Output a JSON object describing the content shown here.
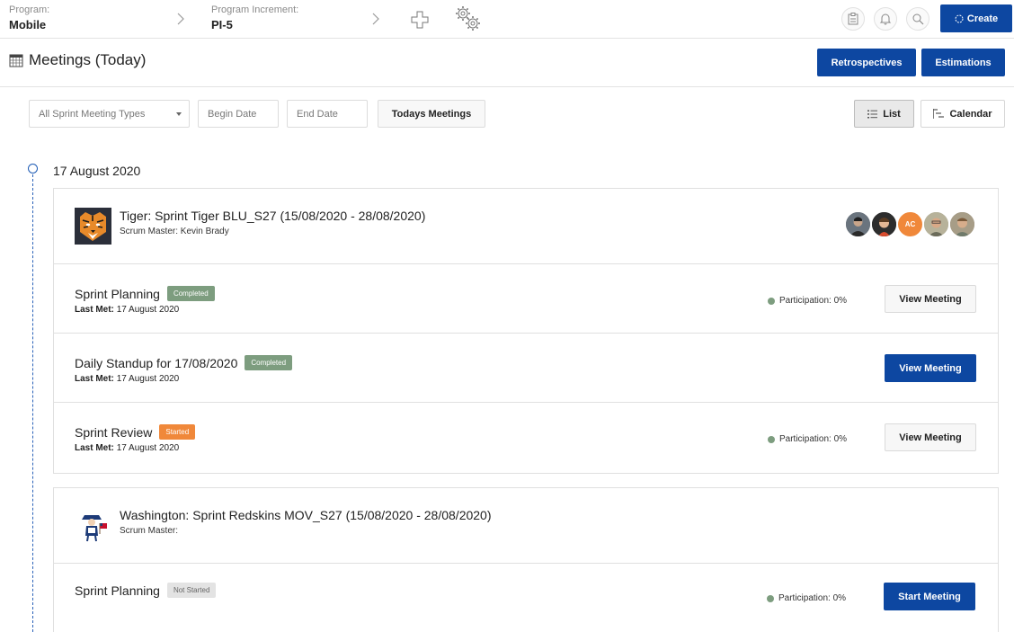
{
  "topbar": {
    "program_label": "Program:",
    "program_value": "Mobile",
    "pi_label": "Program Increment:",
    "pi_value": "PI-5",
    "create_label": "Create"
  },
  "page": {
    "title": "Meetings (Today)",
    "retrospectives_label": "Retrospectives",
    "estimations_label": "Estimations"
  },
  "filters": {
    "meeting_type": "All Sprint Meeting Types",
    "begin_date_placeholder": "Begin Date",
    "end_date_placeholder": "End Date",
    "todays_meetings_label": "Todays Meetings",
    "list_label": "List",
    "calendar_label": "Calendar"
  },
  "timeline": {
    "date": "17 August 2020"
  },
  "sprints": [
    {
      "title": "Tiger: Sprint Tiger BLU_S27 (15/08/2020 - 28/08/2020)",
      "scrum_master": "Scrum Master: Kevin Brady",
      "avatar_initials": "AC",
      "meetings": [
        {
          "name": "Sprint Planning",
          "status": "Completed",
          "last_met_label": "Last Met:",
          "last_met": "17 August 2020",
          "participation": "Participation: 0%",
          "action": "View Meeting"
        },
        {
          "name": "Daily Standup for 17/08/2020",
          "status": "Completed",
          "last_met_label": "Last Met:",
          "last_met": "17 August 2020",
          "participation": "",
          "action": "View Meeting"
        },
        {
          "name": "Sprint Review",
          "status": "Started",
          "last_met_label": "Last Met:",
          "last_met": "17 August 2020",
          "participation": "Participation: 0%",
          "action": "View Meeting"
        }
      ]
    },
    {
      "title": "Washington: Sprint Redskins MOV_S27 (15/08/2020 - 28/08/2020)",
      "scrum_master": "Scrum Master:",
      "meetings": [
        {
          "name": "Sprint Planning",
          "status": "Not Started",
          "participation": "Participation: 0%",
          "action": "Start Meeting"
        }
      ]
    }
  ],
  "colors": {
    "primary": "#0d47a1",
    "completed": "#7d9d7f",
    "started": "#f0883a",
    "not_started": "#e3e3e3"
  }
}
